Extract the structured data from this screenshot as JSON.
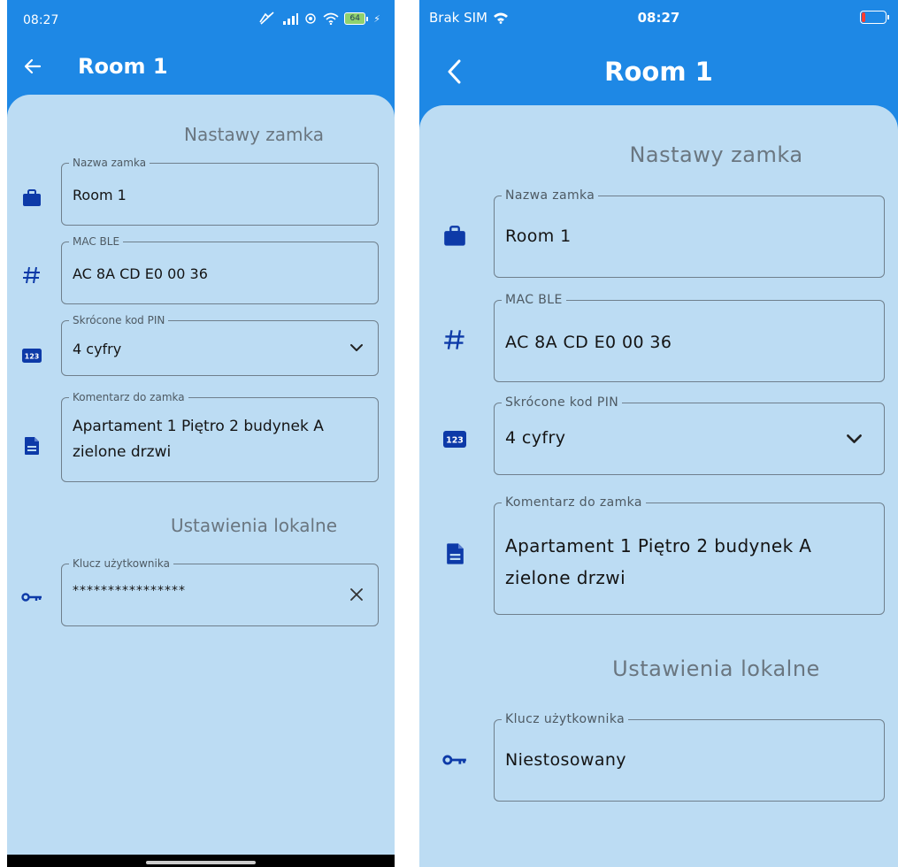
{
  "screens": {
    "android": {
      "status": {
        "time": "08:27",
        "battery": "64"
      },
      "title": "Room 1",
      "sections": {
        "lock_settings": "Nastawy zamka",
        "local_settings": "Ustawienia lokalne"
      },
      "fields": {
        "name": {
          "label": "Nazwa zamka",
          "value": "Room 1"
        },
        "mac": {
          "label": "MAC BLE",
          "value": "AC 8A CD E0 00 36"
        },
        "pin": {
          "label": "Skrócone kod PIN",
          "value": "4 cyfry"
        },
        "comment": {
          "label": "Komentarz do zamka",
          "value": "Apartament 1 Piętro 2 budynek A\nzielone drzwi"
        },
        "user_key": {
          "label": "Klucz użytkownika",
          "value": "****************"
        }
      }
    },
    "ios": {
      "status": {
        "carrier": "Brak SIM",
        "time": "08:27"
      },
      "title": "Room 1",
      "sections": {
        "lock_settings": "Nastawy zamka",
        "local_settings": "Ustawienia lokalne"
      },
      "fields": {
        "name": {
          "label": "Nazwa zamka",
          "value": "Room 1"
        },
        "mac": {
          "label": "MAC BLE",
          "value": "AC 8A CD E0 00 36"
        },
        "pin": {
          "label": "Skrócone kod PIN",
          "value": "4 cyfry"
        },
        "comment": {
          "label": "Komentarz do zamka",
          "value": "Apartament 1 Piętro 2 budynek A\nzielone drzwi"
        },
        "user_key": {
          "label": "Klucz użytkownika",
          "value": "Niestosowany"
        }
      }
    }
  },
  "icons": {
    "name": "briefcase-icon",
    "mac": "hash-icon",
    "pin": "numbers-123-icon",
    "comment": "document-icon",
    "user_key": "key-icon",
    "pin_trailing": "chevron-down-icon",
    "user_key_trailing": "clear-icon"
  },
  "colors": {
    "app_bar": "#1e88e5",
    "sheet": "#bcdcf3",
    "icon": "#0d3aa8",
    "section_title": "#6a7680",
    "field_border": "#6f7f8c",
    "text": "#141414"
  }
}
